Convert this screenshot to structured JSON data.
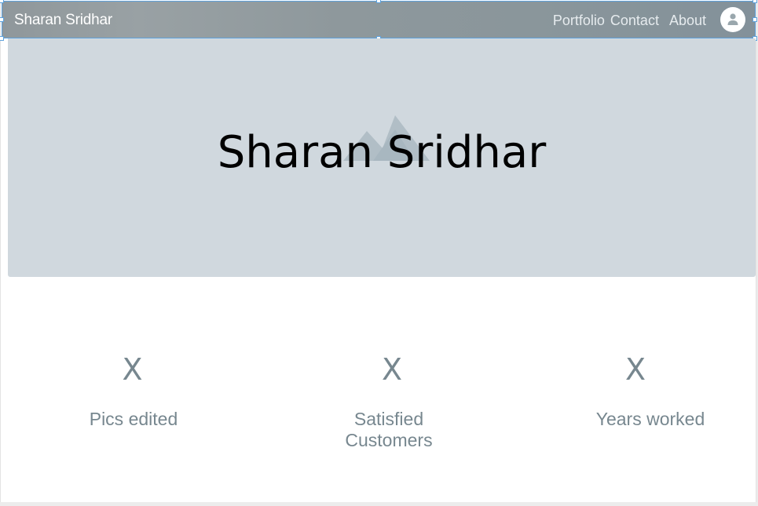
{
  "navbar": {
    "brand": "Sharan Sridhar",
    "links": [
      "Portfolio",
      "Contact",
      "About"
    ],
    "avatar_icon": "user-icon"
  },
  "hero": {
    "title": "Sharan Sridhar",
    "placeholder_icon": "image-placeholder-icon",
    "background": "#d0d8de"
  },
  "stats": [
    {
      "value": "X",
      "label": "Pics edited"
    },
    {
      "value": "X",
      "label": "Satisfied Customers"
    },
    {
      "value": "X",
      "label": "Years worked"
    }
  ],
  "colors": {
    "stat_text": "#77878f",
    "selection": "#5ea2dd"
  }
}
